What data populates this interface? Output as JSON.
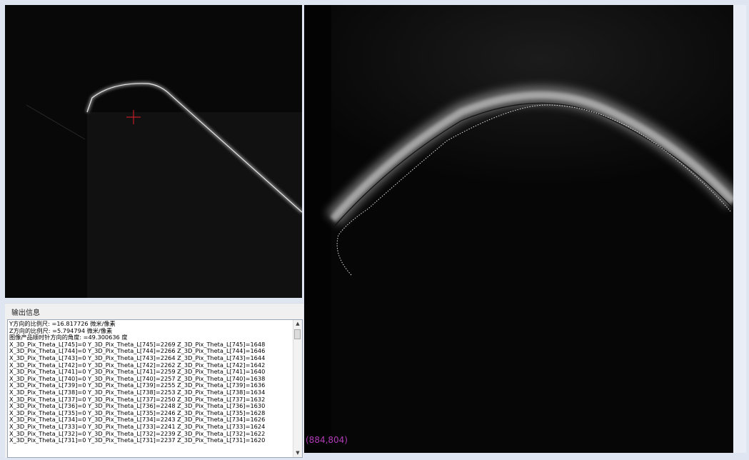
{
  "output": {
    "title": "输出信息",
    "lines": [
      "Y方向的比例尺: =16.817726 微米/像素",
      "Z方向的比例尺: =5.794794 微米/像素",
      "图像产品顺时针方向的角度: =49.300636 度",
      "X_3D_Pix_Theta_L[745]=0 Y_3D_Pix_Theta_L[745]=2269 Z_3D_Pix_Theta_L[745]=1648",
      "X_3D_Pix_Theta_L[744]=0 Y_3D_Pix_Theta_L[744]=2266 Z_3D_Pix_Theta_L[744]=1646",
      "X_3D_Pix_Theta_L[743]=0 Y_3D_Pix_Theta_L[743]=2264 Z_3D_Pix_Theta_L[743]=1644",
      "X_3D_Pix_Theta_L[742]=0 Y_3D_Pix_Theta_L[742]=2262 Z_3D_Pix_Theta_L[742]=1642",
      "X_3D_Pix_Theta_L[741]=0 Y_3D_Pix_Theta_L[741]=2259 Z_3D_Pix_Theta_L[741]=1640",
      "X_3D_Pix_Theta_L[740]=0 Y_3D_Pix_Theta_L[740]=2257 Z_3D_Pix_Theta_L[740]=1638",
      "X_3D_Pix_Theta_L[739]=0 Y_3D_Pix_Theta_L[739]=2255 Z_3D_Pix_Theta_L[739]=1636",
      "X_3D_Pix_Theta_L[738]=0 Y_3D_Pix_Theta_L[738]=2253 Z_3D_Pix_Theta_L[738]=1634",
      "X_3D_Pix_Theta_L[737]=0 Y_3D_Pix_Theta_L[737]=2250 Z_3D_Pix_Theta_L[737]=1632",
      "X_3D_Pix_Theta_L[736]=0 Y_3D_Pix_Theta_L[736]=2248 Z_3D_Pix_Theta_L[736]=1630",
      "X_3D_Pix_Theta_L[735]=0 Y_3D_Pix_Theta_L[735]=2246 Z_3D_Pix_Theta_L[735]=1628",
      "X_3D_Pix_Theta_L[734]=0 Y_3D_Pix_Theta_L[734]=2243 Z_3D_Pix_Theta_L[734]=1626",
      "X_3D_Pix_Theta_L[733]=0 Y_3D_Pix_Theta_L[733]=2241 Z_3D_Pix_Theta_L[733]=1624",
      "X_3D_Pix_Theta_L[732]=0 Y_3D_Pix_Theta_L[732]=2239 Z_3D_Pix_Theta_L[732]=1622",
      "X_3D_Pix_Theta_L[731]=0 Y_3D_Pix_Theta_L[731]=2237 Z_3D_Pix_Theta_L[731]=1620"
    ]
  },
  "coordinate_readout": "(884,804)",
  "colors": {
    "crosshair": "#e0202a",
    "readout": "#b13cb6",
    "background": "#dfe6f1"
  },
  "icons": {
    "scroll_up": "up-arrow-icon",
    "scroll_down": "down-arrow-icon"
  }
}
